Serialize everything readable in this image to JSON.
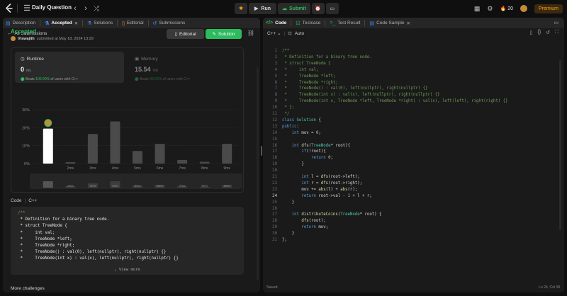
{
  "app": {
    "title": "Daily Question"
  },
  "toolbar": {
    "run": "Run",
    "submit": "Submit",
    "streak": "20",
    "premium": "Premium"
  },
  "left_tabs": [
    {
      "label": "Description"
    },
    {
      "label": "Accepted"
    },
    {
      "label": "Solutions"
    },
    {
      "label": "Editorial"
    },
    {
      "label": "Submissions"
    }
  ],
  "sub": {
    "back": "All Submissions"
  },
  "result": {
    "status": "Accepted",
    "user": "Viswajith",
    "submitted": "submitted at May 18, 2024 13:29",
    "editorial_btn": "Editorial",
    "solution_btn": "Solution"
  },
  "runtime": {
    "label": "Runtime",
    "value": "0",
    "unit": "ms",
    "beats_pre": "Beats",
    "beats_pct": "100.00%",
    "beats_post": "of users with C++"
  },
  "memory": {
    "label": "Memory",
    "value": "15.54",
    "unit": "MB",
    "beats_pre": "Beats",
    "beats_pct": "58.63%",
    "beats_post": "of users with C++"
  },
  "chart_data": {
    "type": "bar",
    "categories": [
      "0ms",
      "2ms",
      "3ms",
      "4ms",
      "5ms",
      "6ms",
      "7ms",
      "8ms",
      "9ms"
    ],
    "values": [
      19.5,
      0.8,
      16.5,
      23.5,
      7,
      11,
      2,
      1,
      11
    ],
    "ylim": [
      0,
      30
    ],
    "yticks": [
      "0%",
      "10%",
      "20%",
      "30%"
    ],
    "highlight_index": 0,
    "colors": {
      "highlight": "#ffffff",
      "bar": "#4a4a4a",
      "grid": "#333333"
    }
  },
  "overview_ticks": [
    "2ms",
    "3ms",
    "4ms",
    "6ms",
    "8ms",
    "7ms",
    "8ms",
    "9ms"
  ],
  "code_section": {
    "label": "Code",
    "lang": "C++",
    "view_more": "View more",
    "more_challenges": "More challenges"
  },
  "preview_lines": [
    "/**",
    " * Definition for a binary tree node.",
    " * struct TreeNode {",
    " *     int val;",
    " *     TreeNode *left;",
    " *     TreeNode *right;",
    " *     TreeNode() : val(0), left(nullptr), right(nullptr) {}",
    " *     TreeNode(int x) : val(x), left(nullptr), right(nullptr) {}"
  ],
  "right_tabs": [
    {
      "label": "Code"
    },
    {
      "label": "Testcase"
    },
    {
      "label": "Test Result"
    },
    {
      "label": "Code Sample"
    }
  ],
  "editor": {
    "lang": "C++",
    "mode": "Auto",
    "status": "Saved",
    "cursor": "Ln 24, Col 38",
    "current_line": 24
  },
  "editor_lines": [
    [
      [
        "c-cm",
        "/**"
      ]
    ],
    [
      [
        "c-cm",
        " * Definition for a binary tree node."
      ]
    ],
    [
      [
        "c-cm",
        " * struct TreeNode {"
      ]
    ],
    [
      [
        "c-cm",
        " *     int val;"
      ]
    ],
    [
      [
        "c-cm",
        " *     TreeNode *left;"
      ]
    ],
    [
      [
        "c-cm",
        " *     TreeNode *right;"
      ]
    ],
    [
      [
        "c-cm",
        " *     TreeNode() : val(0), left(nullptr), right(nullptr) {}"
      ]
    ],
    [
      [
        "c-cm",
        " *     TreeNode(int x) : val(x), left(nullptr), right(nullptr) {}"
      ]
    ],
    [
      [
        "c-cm",
        " *     TreeNode(int x, TreeNode *left, TreeNode *right) : val(x), left(left), right(right) {}"
      ]
    ],
    [
      [
        "c-cm",
        " * };"
      ]
    ],
    [
      [
        "c-cm",
        " */"
      ]
    ],
    [
      [
        "c-kw",
        "class "
      ],
      [
        "c-ty",
        "Solution"
      ],
      [
        "c-pl",
        " {"
      ]
    ],
    [
      [
        "c-kw",
        "public"
      ],
      [
        "c-pl",
        ":"
      ]
    ],
    [
      [
        "c-kw",
        "    int "
      ],
      [
        "c-pl",
        "mov = "
      ],
      [
        "c-nm",
        "0"
      ],
      [
        "c-pl",
        ";"
      ]
    ],
    [
      [
        "c-pl",
        ""
      ]
    ],
    [
      [
        "c-kw",
        "    int "
      ],
      [
        "c-fn",
        "dfs"
      ],
      [
        "c-pl",
        "("
      ],
      [
        "c-ty",
        "TreeNode"
      ],
      [
        "c-pl",
        "* root){"
      ]
    ],
    [
      [
        "c-kw",
        "        if"
      ],
      [
        "c-pl",
        "(!root){"
      ]
    ],
    [
      [
        "c-kw",
        "            return "
      ],
      [
        "c-nm",
        "0"
      ],
      [
        "c-pl",
        ";"
      ]
    ],
    [
      [
        "c-pl",
        "        }"
      ]
    ],
    [
      [
        "c-pl",
        ""
      ]
    ],
    [
      [
        "c-kw",
        "        int "
      ],
      [
        "c-pl",
        "l = "
      ],
      [
        "c-fn",
        "dfs"
      ],
      [
        "c-pl",
        "(root->left);"
      ]
    ],
    [
      [
        "c-kw",
        "        int "
      ],
      [
        "c-pl",
        "r = "
      ],
      [
        "c-fn",
        "dfs"
      ],
      [
        "c-pl",
        "(root->right);"
      ]
    ],
    [
      [
        "c-pl",
        "        mov += "
      ],
      [
        "c-fn",
        "abs"
      ],
      [
        "c-pl",
        "(l) + "
      ],
      [
        "c-fn",
        "abs"
      ],
      [
        "c-pl",
        "(r);"
      ]
    ],
    [
      [
        "c-kw",
        "        return "
      ],
      [
        "c-pl",
        "root->val - "
      ],
      [
        "c-nm",
        "1"
      ],
      [
        "c-pl",
        " + l + r;"
      ]
    ],
    [
      [
        "c-pl",
        "    }"
      ]
    ],
    [
      [
        "c-pl",
        ""
      ]
    ],
    [
      [
        "c-kw",
        "    int "
      ],
      [
        "c-fn",
        "distributeCoins"
      ],
      [
        "c-pl",
        "("
      ],
      [
        "c-ty",
        "TreeNode"
      ],
      [
        "c-pl",
        "* root) {"
      ]
    ],
    [
      [
        "c-fn",
        "        dfs"
      ],
      [
        "c-pl",
        "(root);"
      ]
    ],
    [
      [
        "c-kw",
        "        return "
      ],
      [
        "c-pl",
        "mov;"
      ]
    ],
    [
      [
        "c-pl",
        "    }"
      ]
    ],
    [
      [
        "c-pl",
        "};"
      ]
    ]
  ]
}
